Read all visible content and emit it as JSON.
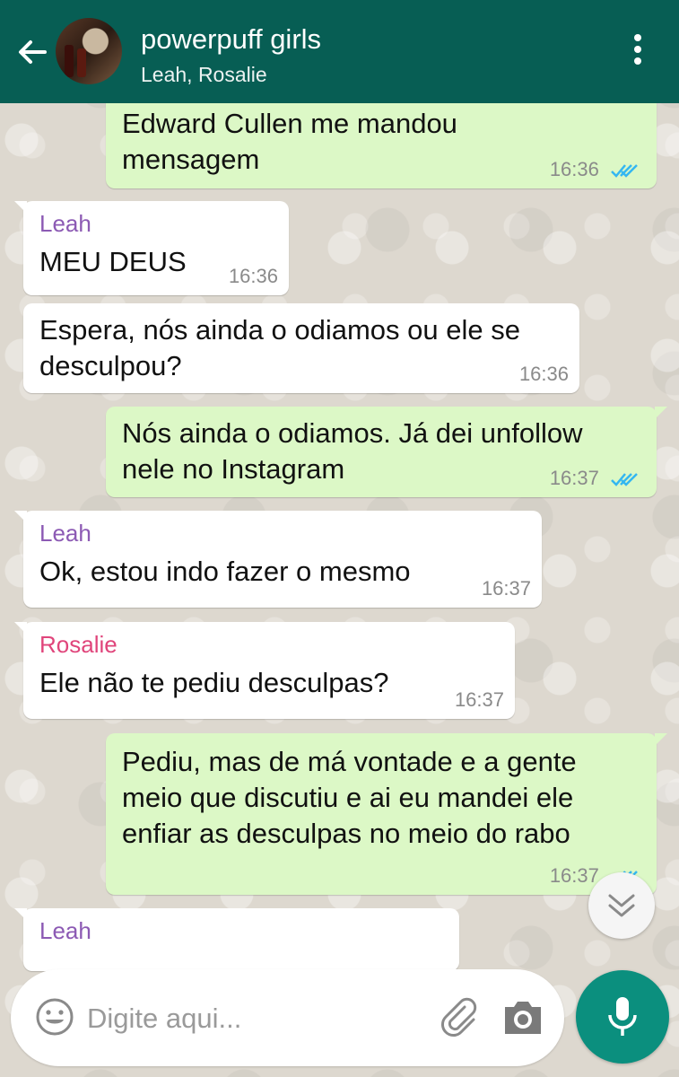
{
  "header": {
    "title": "powerpuff girls",
    "subtitle": "Leah, Rosalie"
  },
  "messages": [
    {
      "direction": "out",
      "text": "Edward Cullen me mandou mensagem",
      "time": "16:36",
      "status": "read"
    },
    {
      "direction": "in",
      "sender": "Leah",
      "text": "MEU DEUS",
      "time": "16:36"
    },
    {
      "direction": "in",
      "text": "Espera, nós ainda o odiamos ou ele se desculpou?",
      "time": "16:36"
    },
    {
      "direction": "out",
      "text": "Nós ainda o odiamos. Já dei unfollow nele no Instagram",
      "time": "16:37",
      "status": "read"
    },
    {
      "direction": "in",
      "sender": "Leah",
      "text": "Ok, estou indo fazer o mesmo",
      "time": "16:37"
    },
    {
      "direction": "in",
      "sender": "Rosalie",
      "text": "Ele não te pediu desculpas?",
      "time": "16:37"
    },
    {
      "direction": "out",
      "text": "Pediu, mas de má vontade e a gente meio que discutiu e ai eu mandei ele enfiar as desculpas no meio do rabo",
      "time": "16:37",
      "status": "read"
    },
    {
      "direction": "in",
      "sender": "Leah",
      "text": "",
      "time": ""
    }
  ],
  "composer": {
    "placeholder": "Digite aqui..."
  },
  "colors": {
    "header": "#075e54",
    "outgoing_bubble": "#dcf8c6",
    "incoming_bubble": "#ffffff",
    "read_ticks": "#34b7f1",
    "sender_leah": "#8c5ab4",
    "sender_rosalie": "#e0457b",
    "mic_button": "#0b8f7e"
  },
  "icons": [
    "back-arrow-icon",
    "menu-dots-icon",
    "read-ticks-icon",
    "chevron-double-down-icon",
    "emoji-icon",
    "paperclip-icon",
    "camera-icon",
    "mic-icon"
  ]
}
